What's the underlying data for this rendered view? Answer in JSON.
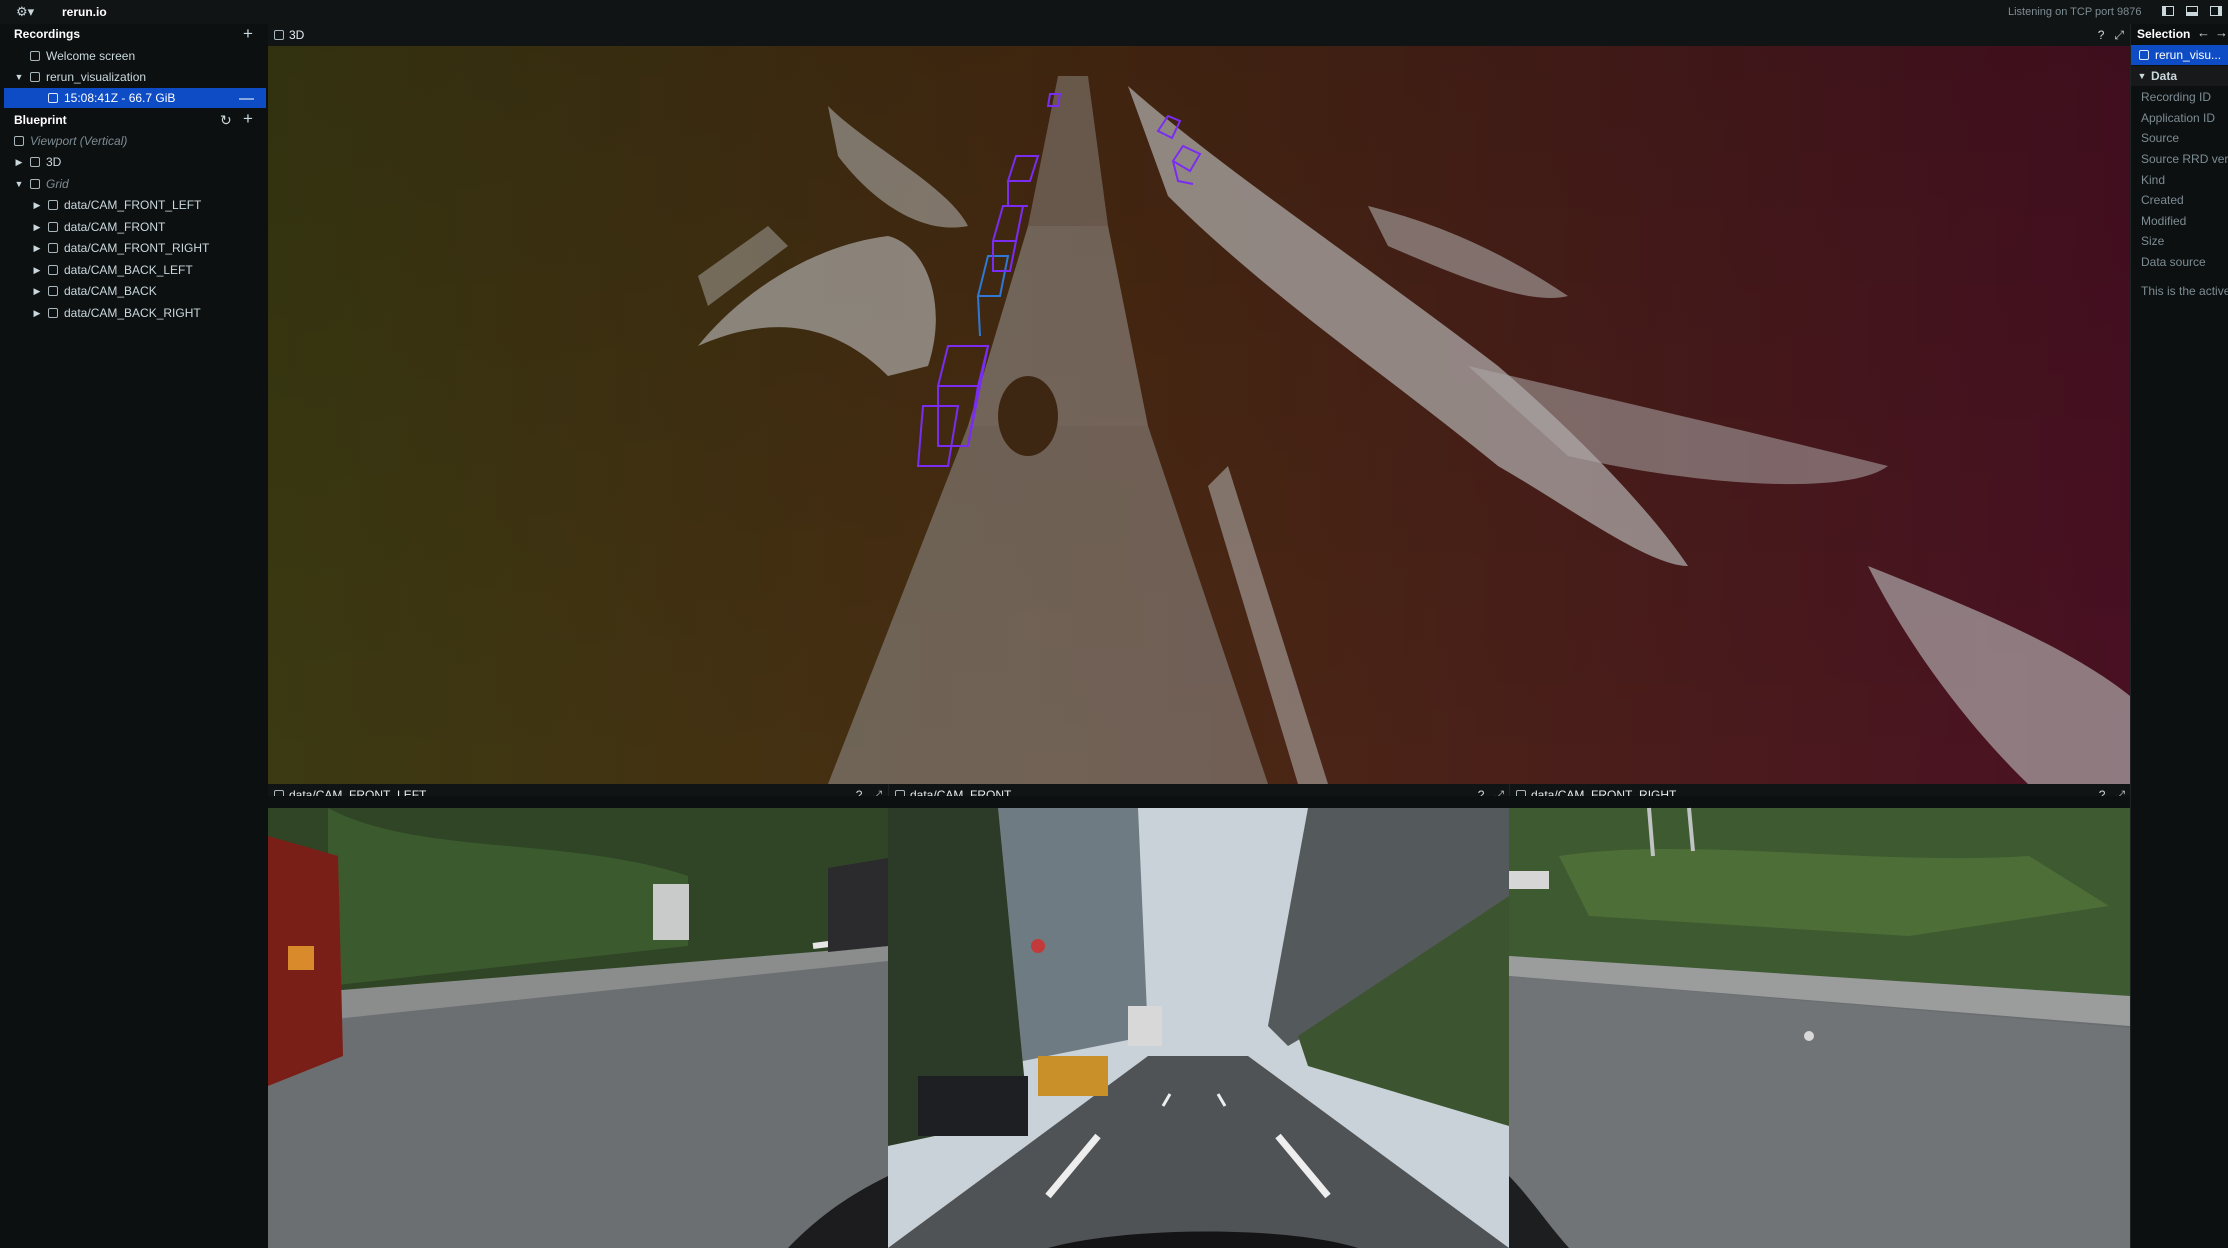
{
  "app": {
    "title": "rerun.io",
    "status": "Listening on TCP port 9876"
  },
  "recordings": {
    "header": "Recordings",
    "items": [
      {
        "label": "Welcome screen"
      },
      {
        "label": "rerun_visualization"
      },
      {
        "label": "15:08:41Z - 66.7 GiB"
      }
    ]
  },
  "blueprint": {
    "header": "Blueprint",
    "viewport": "Viewport (Vertical)",
    "view3d": "3D",
    "grid": "Grid",
    "cameras": [
      "data/CAM_FRONT_LEFT",
      "data/CAM_FRONT",
      "data/CAM_FRONT_RIGHT",
      "data/CAM_BACK_LEFT",
      "data/CAM_BACK",
      "data/CAM_BACK_RIGHT"
    ]
  },
  "views": {
    "main3d": "3D",
    "front_left": "data/CAM_FRONT_LEFT",
    "front": "data/CAM_FRONT",
    "front_right": "data/CAM_FRONT_RIGHT",
    "help": "?"
  },
  "selection": {
    "header": "Selection",
    "item": "rerun_visu...",
    "section": "Data",
    "fields": [
      "Recording ID",
      "Application ID",
      "Source",
      "Source RRD versi",
      "Kind",
      "Created",
      "Modified",
      "Size",
      "Data source"
    ],
    "note": "This is the active"
  },
  "colors": {
    "accent": "#0d4cc4",
    "panel": "#111415",
    "background": "#0d1011",
    "bbox": "#7a2df0"
  }
}
